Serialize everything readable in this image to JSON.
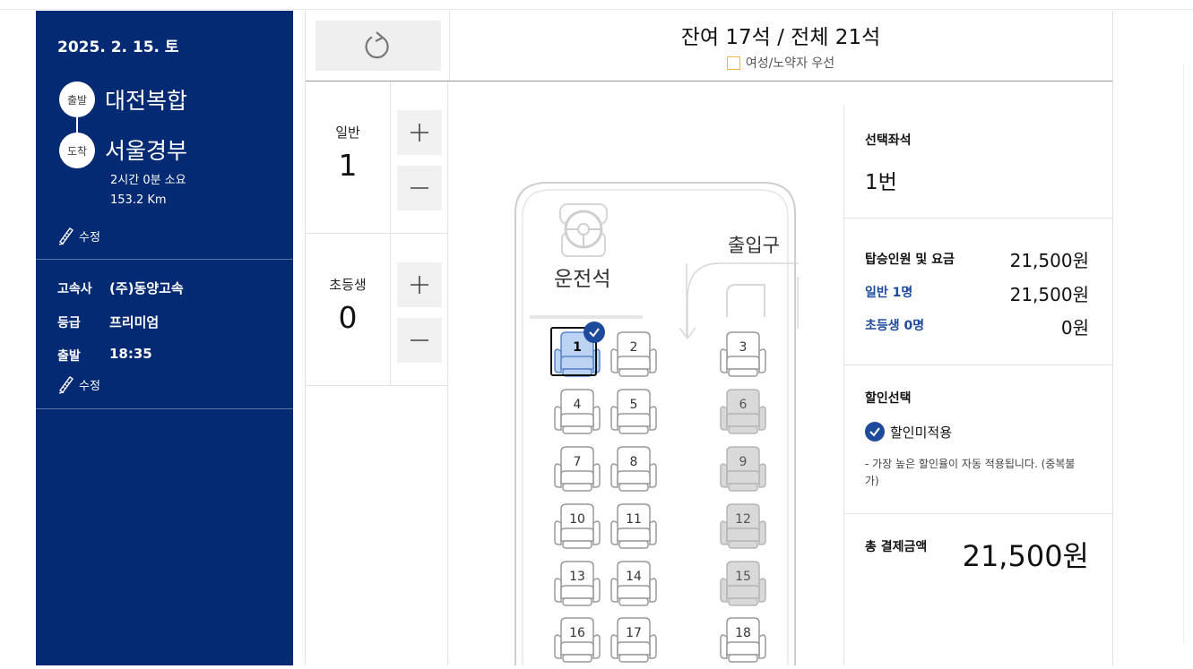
{
  "trip": {
    "date": "2025. 2. 15. 토",
    "departure_tag": "출발",
    "departure": "대전복합",
    "arrival_tag": "도착",
    "arrival": "서울경부",
    "duration": "2시간 0분 소요",
    "distance": "153.2 Km",
    "edit_label": "수정"
  },
  "bus_info": {
    "company_label": "고속사",
    "company": "(주)동양고속",
    "grade_label": "등급",
    "grade": "프리미엄",
    "depart_label": "출발",
    "depart_time": "18:35",
    "edit_label": "수정"
  },
  "header": {
    "remaining": "잔여 17석 / 전체 21석",
    "priority_label": "여성/노약자 우선"
  },
  "passengers": [
    {
      "label": "일반",
      "count": "1"
    },
    {
      "label": "초등생",
      "count": "0"
    }
  ],
  "bus_layout": {
    "driver_label": "운전석",
    "entrance_label": "출입구",
    "seats": [
      {
        "num": "1",
        "state": "selected"
      },
      {
        "num": "2",
        "state": "available"
      },
      {
        "num": "3",
        "state": "available"
      },
      {
        "num": "4",
        "state": "available"
      },
      {
        "num": "5",
        "state": "available"
      },
      {
        "num": "6",
        "state": "occupied"
      },
      {
        "num": "7",
        "state": "available"
      },
      {
        "num": "8",
        "state": "available"
      },
      {
        "num": "9",
        "state": "occupied"
      },
      {
        "num": "10",
        "state": "available"
      },
      {
        "num": "11",
        "state": "available"
      },
      {
        "num": "12",
        "state": "occupied"
      },
      {
        "num": "13",
        "state": "available"
      },
      {
        "num": "14",
        "state": "available"
      },
      {
        "num": "15",
        "state": "occupied"
      },
      {
        "num": "16",
        "state": "available"
      },
      {
        "num": "17",
        "state": "available"
      },
      {
        "num": "18",
        "state": "available"
      }
    ]
  },
  "summary": {
    "selected_title": "선택좌석",
    "selected_value": "1번",
    "fare_title": "탑승인원 및 요금",
    "fare_total": "21,500원",
    "adult_label": "일반 1명",
    "adult_fare": "21,500원",
    "child_label": "초등생 0명",
    "child_fare": "0원",
    "discount_title": "할인선택",
    "discount_option": "할인미적용",
    "discount_note": "- 가장 높은 할인율이 자동 적용됩니다. (중복불가)",
    "total_title": "총 결제금액",
    "total_value": "21,500원"
  },
  "colors": {
    "sidebar_bg": "#032a72",
    "accent": "#1e4a9c",
    "selected_seat": "#bcd3f3",
    "occupied_seat": "#d9d9d9",
    "priority_box": "#f2b74a"
  }
}
